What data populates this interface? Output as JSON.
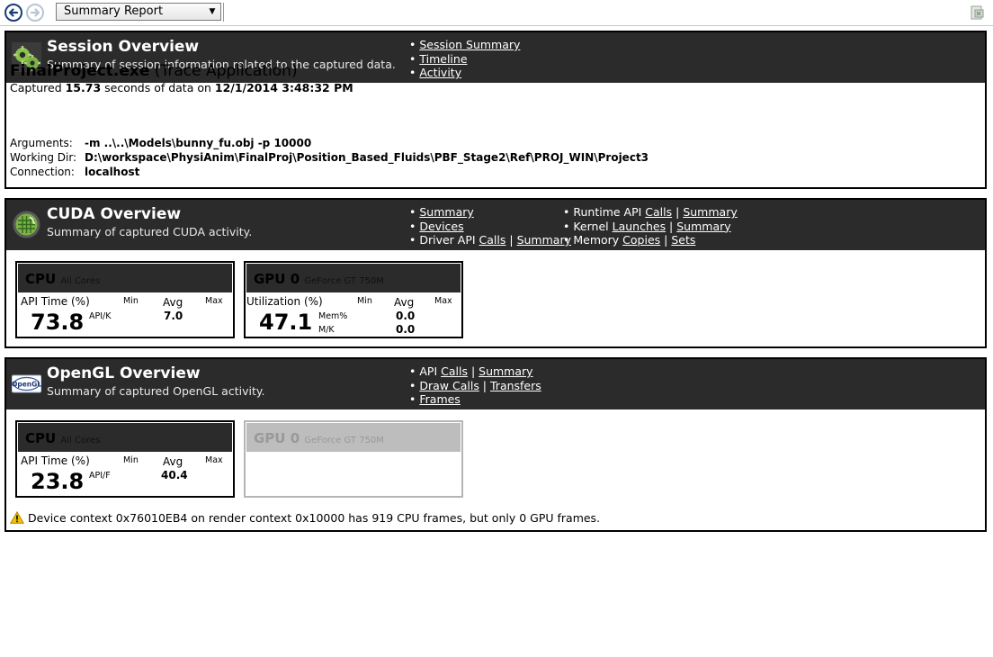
{
  "toolbar": {
    "report_select": "Summary Report"
  },
  "session": {
    "title": "Session Overview",
    "subtitle": "Summary of session information related to the captured data.",
    "links": [
      "Session Summary",
      "Timeline",
      "Activity"
    ],
    "app_name": "FinalProject.exe",
    "app_type": "(Trace Application)",
    "captured_prefix": "Captured ",
    "captured_seconds": "15.73",
    "captured_mid": " seconds of data on ",
    "captured_date": "12/1/2014 3:48:32 PM",
    "arguments_label": "Arguments:",
    "arguments": "-m ..\\..\\Models\\bunny_fu.obj -p 10000",
    "workdir_label": "Working Dir:",
    "workdir": "D:\\workspace\\PhysiAnim\\FinalProj\\Position_Based_Fluids\\PBF_Stage2\\Ref\\PROJ_WIN\\Project3",
    "connection_label": "Connection:",
    "connection": "localhost"
  },
  "cuda": {
    "title": "CUDA Overview",
    "subtitle": "Summary of captured CUDA activity.",
    "links_left": {
      "summary": "Summary",
      "devices": "Devices",
      "driver_prefix": "Driver API ",
      "driver_calls": "Calls",
      "driver_summary": "Summary"
    },
    "links_right": {
      "runtime_prefix": "Runtime API ",
      "runtime_calls": "Calls",
      "runtime_summary": "Summary",
      "kernel_prefix": "Kernel ",
      "kernel_launches": "Launches",
      "kernel_summary": "Summary",
      "memory_prefix": "Memory ",
      "memory_copies": "Copies",
      "memory_sets": "Sets"
    },
    "cpu_card": {
      "name": "CPU",
      "sub": "All Cores",
      "label": "API Time (%)",
      "value": "73.8",
      "unit": "API/K",
      "min": "Min",
      "avg": "Avg",
      "max": "Max",
      "avg_value": "7.0"
    },
    "gpu_card": {
      "name": "GPU 0",
      "sub": "GeForce GT 750M",
      "label": "Utilization (%)",
      "value": "47.1",
      "min": "Min",
      "avg": "Avg",
      "max": "Max",
      "mem_label": "Mem%",
      "mem_value": "0.0",
      "mk_label": "M/K",
      "mk_value": "0.0"
    }
  },
  "opengl": {
    "title": "OpenGL Overview",
    "subtitle": "Summary of captured OpenGL activity.",
    "links": {
      "api_prefix": "API ",
      "api_calls": "Calls",
      "api_summary": "Summary",
      "draw_calls": "Draw Calls",
      "transfers": "Transfers",
      "frames": "Frames"
    },
    "cpu_card": {
      "name": "CPU",
      "sub": "All Cores",
      "label": "API Time (%)",
      "value": "23.8",
      "unit": "API/F",
      "min": "Min",
      "avg": "Avg",
      "max": "Max",
      "avg_value": "40.4"
    },
    "gpu_card": {
      "name": "GPU 0",
      "sub": "GeForce GT 750M"
    },
    "warning": "Device context 0x76010EB4 on render context 0x10000 has 919 CPU frames, but only 0 GPU frames."
  },
  "colors": {
    "header_bg": "#2b2b2b",
    "border": "#000000",
    "disabled": "#bdbdbd",
    "warning": "#f0c000"
  }
}
